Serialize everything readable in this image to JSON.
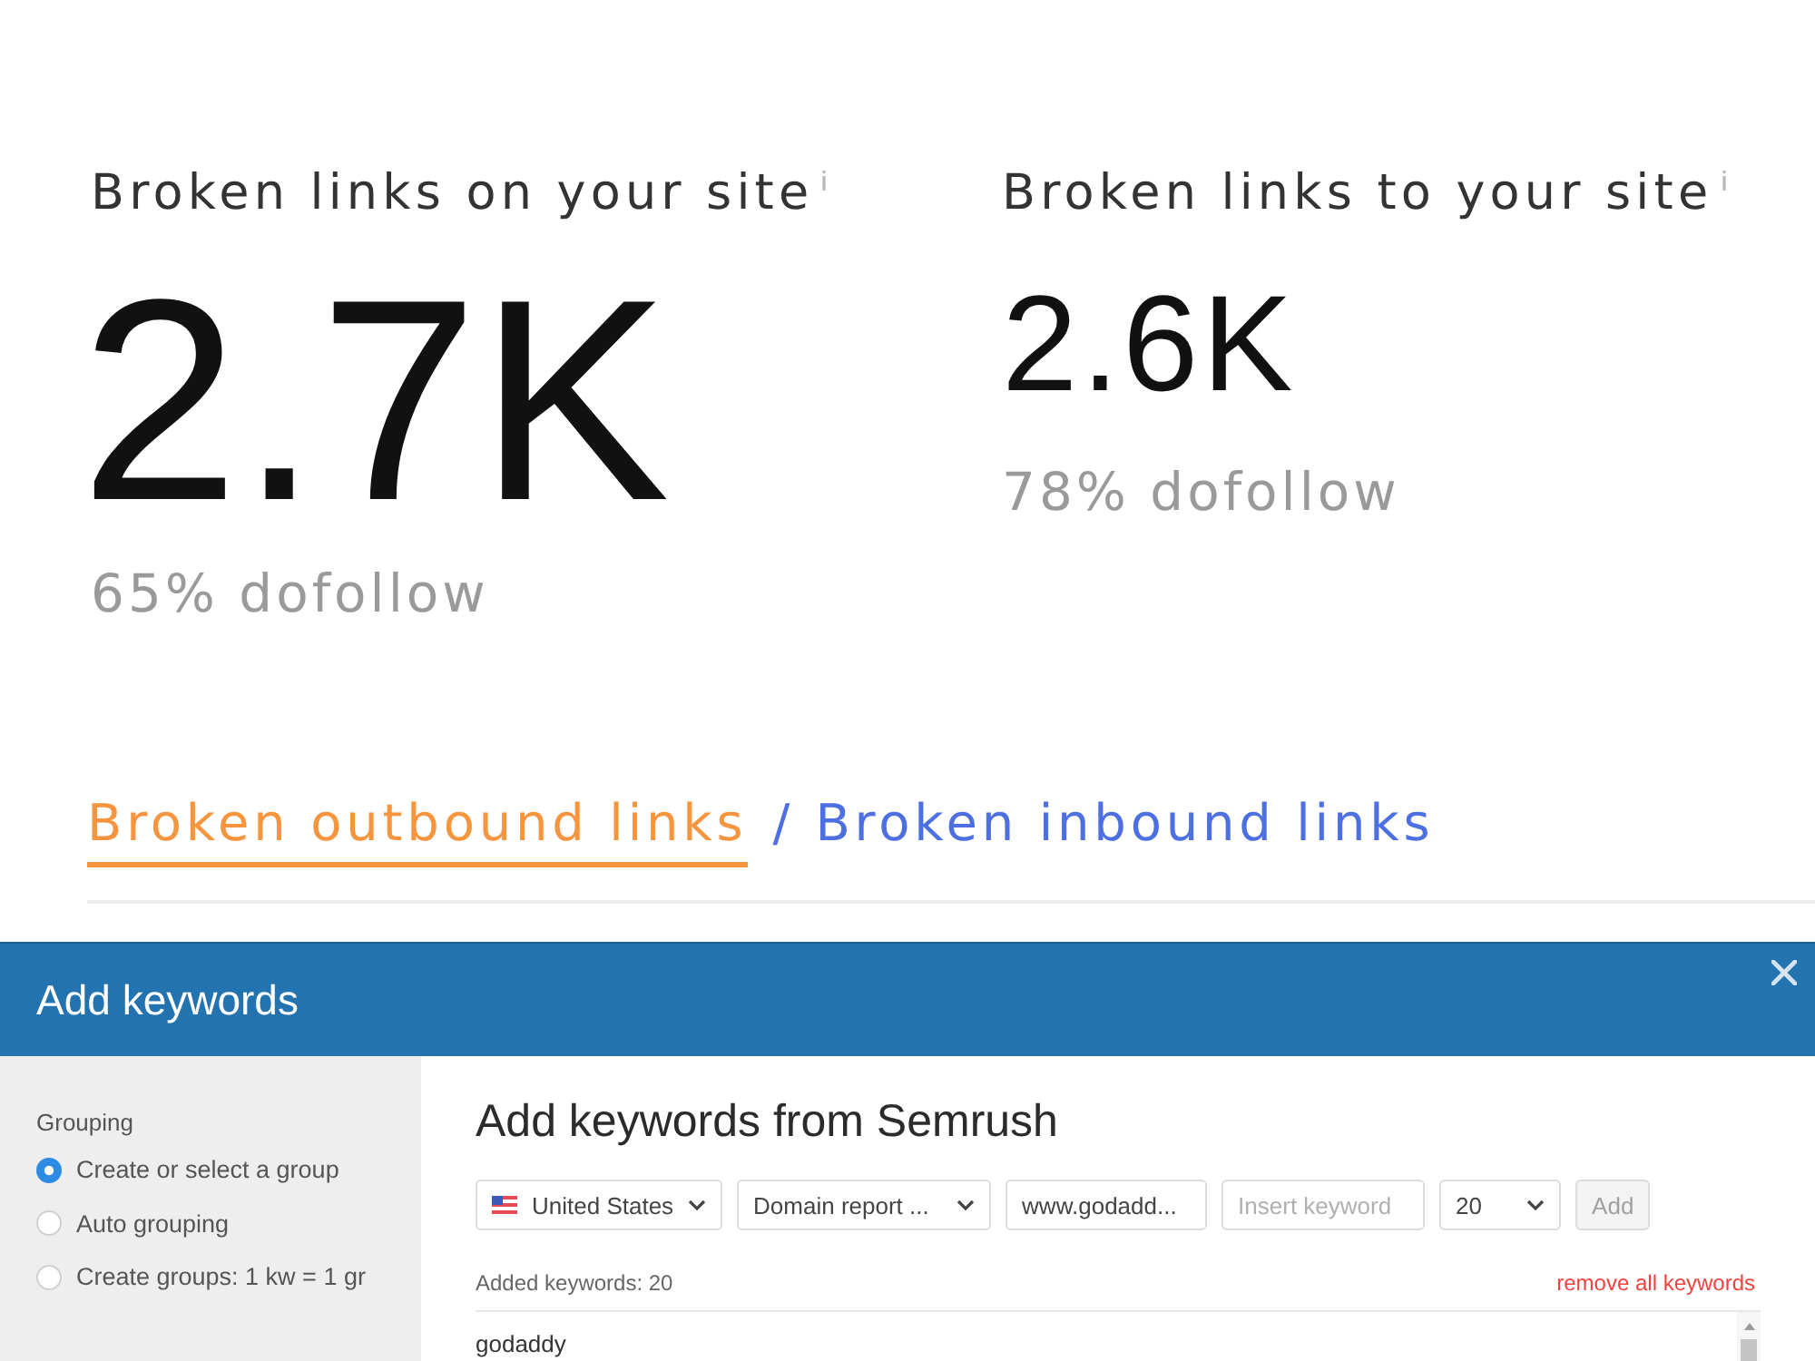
{
  "stats": [
    {
      "kind": "primary",
      "title": "Broken links on your site",
      "value": "2.7K",
      "note": "65% dofollow"
    },
    {
      "kind": "secondary",
      "title": "Broken links to your site",
      "value": "2.6K",
      "note": "78% dofollow"
    }
  ],
  "tabs": {
    "items": [
      {
        "label": "Broken outbound links",
        "selected": true
      },
      {
        "label": "Broken inbound links",
        "selected": false
      }
    ],
    "separator": "/"
  },
  "dialog": {
    "title": "Add keywords",
    "sidebar": {
      "heading": "Grouping",
      "options": [
        {
          "label": "Create or select a group",
          "selected": true
        },
        {
          "label": "Auto grouping",
          "selected": false
        },
        {
          "label": "Create groups: 1 kw = 1 gr",
          "selected": false
        }
      ]
    },
    "main": {
      "heading": "Add keywords from Semrush",
      "country": "United States",
      "report": "Domain report ...",
      "domain": "www.godadd...",
      "keyword": {
        "placeholder": "Insert keyword"
      },
      "count": "20",
      "add_button": {
        "label": "Add",
        "disabled": true
      },
      "added_label": "Added keywords: 20",
      "remove_link": "remove all keywords",
      "keywords": [
        "godaddy"
      ]
    }
  }
}
